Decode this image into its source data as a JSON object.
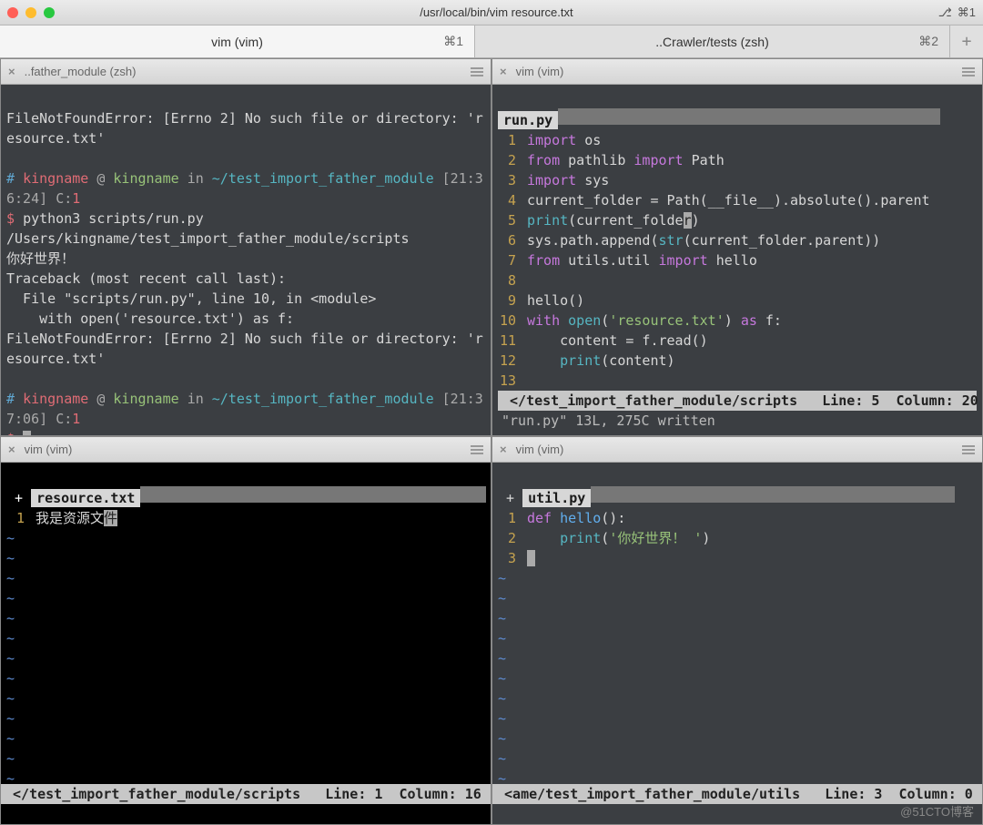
{
  "window": {
    "title": "/usr/local/bin/vim resource.txt",
    "shortcut_right": "⌘1"
  },
  "tabs": [
    {
      "label": "vim (vim)",
      "shortcut": "⌘1"
    },
    {
      "label": "..Crawler/tests (zsh)",
      "shortcut": "⌘2"
    }
  ],
  "pane_tl": {
    "head": "..father_module (zsh)",
    "err1a": "FileNotFoundError: [Errno 2] No such file or directory: 'r",
    "err1b": "esource.txt'",
    "prompt1": {
      "hash": "#",
      "user": "kingname",
      "at": "@",
      "host": "kingname",
      "in": "in",
      "path": "~/test_import_father_module",
      "time": "[21:3",
      "time2": "6:24]",
      "c": "C:",
      "cn": "1"
    },
    "cmd": "$ python3 scripts/run.py",
    "out1": "/Users/kingname/test_import_father_module/scripts",
    "out2": "你好世界！",
    "tb1": "Traceback (most recent call last):",
    "tb2": "  File \"scripts/run.py\", line 10, in <module>",
    "tb3": "    with open('resource.txt') as f:",
    "err2a": "FileNotFoundError: [Errno 2] No such file or directory: 'r",
    "err2b": "esource.txt'",
    "prompt2": {
      "hash": "#",
      "user": "kingname",
      "at": "@",
      "host": "kingname",
      "in": "in",
      "path": "~/test_import_father_module",
      "time": "[21:3",
      "time2": "7:06]",
      "c": "C:",
      "cn": "1"
    },
    "prompt_end": "$"
  },
  "pane_tr": {
    "head": "vim (vim)",
    "filename": "run.py",
    "lines": {
      "l1": {
        "n": "1",
        "kw": "import",
        "mod": "os"
      },
      "l2": {
        "n": "2",
        "kw": "from",
        "mod": "pathlib",
        "kw2": "import",
        "cls": "Path"
      },
      "l3": {
        "n": "3",
        "kw": "import",
        "mod": "sys"
      },
      "l4": {
        "n": "4",
        "a": "current_folder = Path(",
        "b": "__file__",
        "c": ").absolute().parent"
      },
      "l5": {
        "n": "5",
        "fn": "print",
        "a": "(current_folder)"
      },
      "l6": {
        "n": "6",
        "a": "sys.path.append(",
        "fn": "str",
        "b": "(current_folder.parent))"
      },
      "l7": {
        "n": "7",
        "kw": "from",
        "mod": "utils.util",
        "kw2": "import",
        "name": "hello"
      },
      "l8": {
        "n": "8"
      },
      "l9": {
        "n": "9",
        "a": "hello()"
      },
      "l10": {
        "n": "10",
        "kw": "with",
        "fn": "open",
        "a": "(",
        "str": "'resource.txt'",
        "b": ")",
        "kw2": "as",
        "c": " f:"
      },
      "l11": {
        "n": "11",
        "a": "    content = f.read()"
      },
      "l12": {
        "n": "12",
        "sp": "    ",
        "fn": "print",
        "a": "(content)"
      },
      "l13": {
        "n": "13"
      }
    },
    "status": " </test_import_father_module/scripts   Line: 5  Column: 20",
    "msg": "\"run.py\" 13L, 275C written"
  },
  "pane_bl": {
    "head": "vim (vim)",
    "mod": "+",
    "filename": "resource.txt",
    "line1_n": "1",
    "line1": "我是资源文",
    "line1_cur": "件",
    "tilde": "~",
    "status": " </test_import_father_module/scripts   Line: 1  Column: 16"
  },
  "pane_br": {
    "head": "vim (vim)",
    "mod": "+",
    "filename": "util.py",
    "lines": {
      "l1": {
        "n": "1",
        "kw": "def",
        "fn": "hello",
        "a": "():"
      },
      "l2": {
        "n": "2",
        "sp": "    ",
        "fn": "print",
        "a": "(",
        "str": "'你好世界！ '",
        "b": ")"
      },
      "l3": {
        "n": "3"
      }
    },
    "tilde": "~",
    "status": " <ame/test_import_father_module/utils   Line: 3  Column: 0"
  },
  "watermark": "@51CTO博客"
}
